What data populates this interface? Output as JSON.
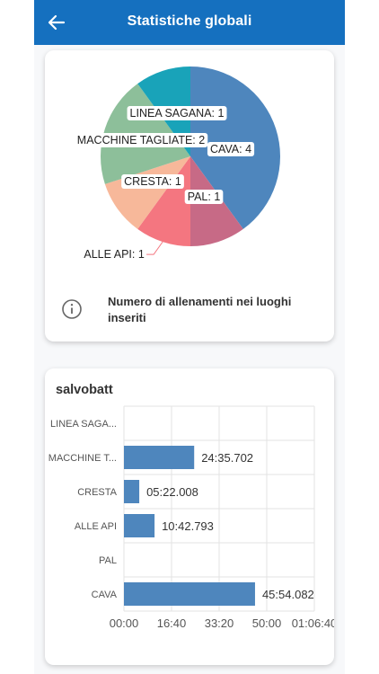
{
  "header": {
    "title": "Statistiche globali",
    "back_icon": "arrow-left-icon"
  },
  "pie_card": {
    "info_text": "Numero di allenamenti nei luoghi inseriti",
    "info_icon": "info-icon"
  },
  "bar_card": {
    "title": "salvobatt"
  },
  "chart_data": [
    {
      "type": "pie",
      "slices": [
        {
          "label": "CAVA: 4",
          "name": "CAVA",
          "value": 4,
          "color": "#4e86bd"
        },
        {
          "label": "PAL: 1",
          "name": "PAL",
          "value": 1,
          "color": "#c76a86"
        },
        {
          "label": "ALLE API: 1",
          "name": "ALLE API",
          "value": 1,
          "color": "#f47680"
        },
        {
          "label": "CRESTA: 1",
          "name": "CRESTA",
          "value": 1,
          "color": "#f7b89a"
        },
        {
          "label": "MACCHINE TAGLIATE: 2",
          "name": "MACCHINE TAGLIATE",
          "value": 2,
          "color": "#8dbf9a"
        },
        {
          "label": "LINEA SAGANA: 1",
          "name": "LINEA SAGANA",
          "value": 1,
          "color": "#19a3b9"
        }
      ]
    },
    {
      "type": "bar",
      "orientation": "horizontal",
      "title": "salvobatt",
      "categories": [
        "LINEA SAGA...",
        "MACCHINE T...",
        "CRESTA",
        "ALLE API",
        "PAL",
        "CAVA"
      ],
      "values_seconds": [
        0,
        1475.702,
        322.008,
        642.793,
        0,
        2754.082
      ],
      "value_labels": [
        "",
        "24:35.702",
        "05:22.008",
        "10:42.793",
        "",
        "45:54.082"
      ],
      "x_ticks": [
        "00:00",
        "16:40",
        "33:20",
        "50:00",
        "01:06:40"
      ],
      "xlim_seconds": [
        0,
        4000
      ],
      "color": "#4e86bd",
      "grid": true
    }
  ]
}
